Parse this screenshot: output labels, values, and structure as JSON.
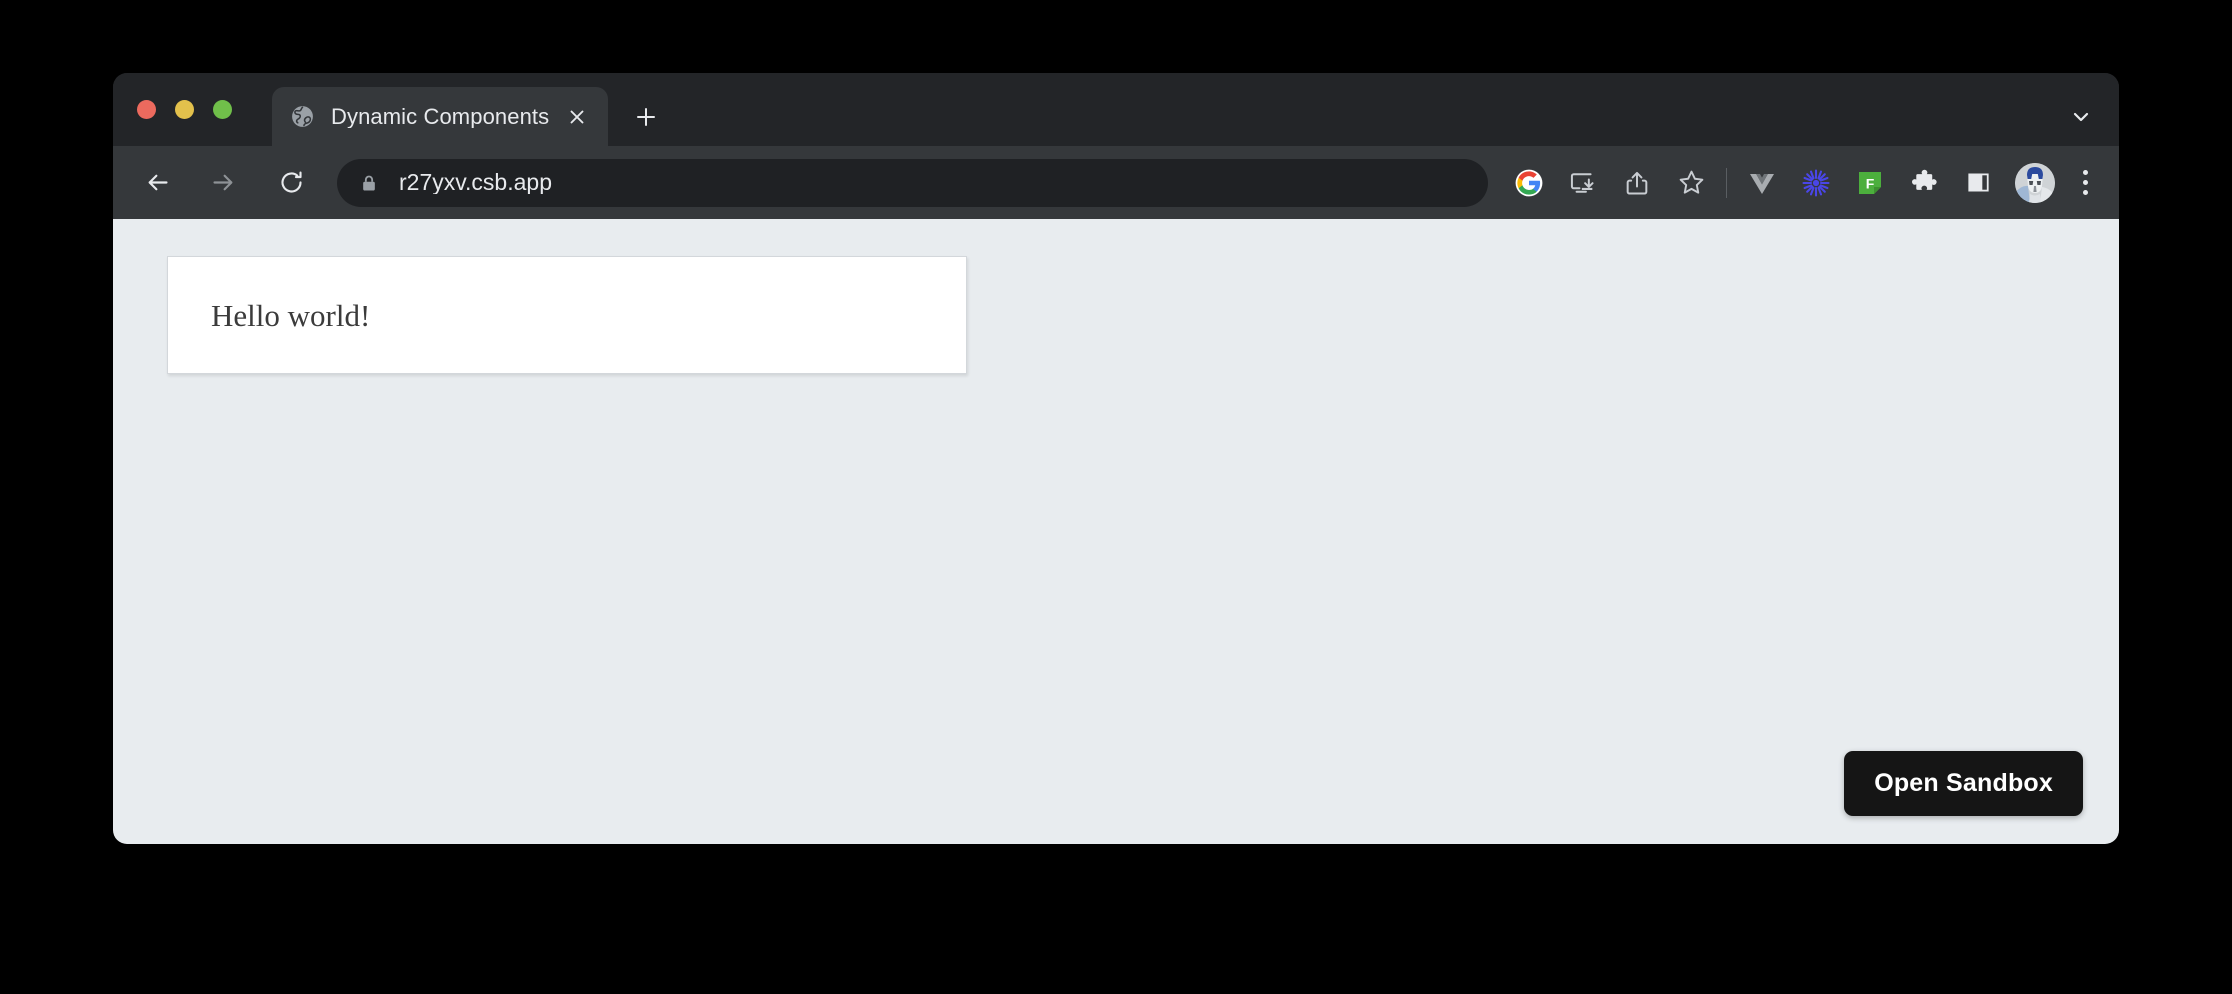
{
  "window": {
    "traffic_lights": [
      {
        "name": "close",
        "color": "#ec6a5e"
      },
      {
        "name": "minimize",
        "color": "#e3c14c"
      },
      {
        "name": "maximize",
        "color": "#70bf4a"
      }
    ]
  },
  "tab_strip": {
    "tabs": [
      {
        "title": "Dynamic Components",
        "favicon": "globe-icon",
        "close_label": "×",
        "active": true
      }
    ],
    "new_tab_label": "+",
    "tab_search_icon": "chevron-down-icon"
  },
  "toolbar": {
    "back_icon": "arrow-left-icon",
    "forward_icon": "arrow-right-icon",
    "reload_icon": "reload-icon",
    "omnibox": {
      "security_icon": "lock-icon",
      "url": "r27yxv.csb.app"
    },
    "actions": [
      {
        "name": "google-search-icon",
        "label": "G"
      },
      {
        "name": "install-app-icon",
        "label": ""
      },
      {
        "name": "share-icon",
        "label": ""
      },
      {
        "name": "bookmark-star-icon",
        "label": ""
      },
      {
        "name": "vue-devtools-icon",
        "label": "V"
      },
      {
        "name": "extension-burst-icon",
        "label": ""
      },
      {
        "name": "extension-f-icon",
        "label": "F"
      },
      {
        "name": "extensions-puzzle-icon",
        "label": ""
      },
      {
        "name": "side-panel-icon",
        "label": ""
      }
    ],
    "profile_icon": "avatar",
    "menu_icon": "three-dot-menu-icon"
  },
  "page": {
    "background_color": "#e8ecef",
    "card": {
      "text": "Hello world!"
    },
    "open_sandbox_button": {
      "label": "Open Sandbox",
      "background_color": "#151515",
      "text_color": "#ffffff"
    }
  }
}
